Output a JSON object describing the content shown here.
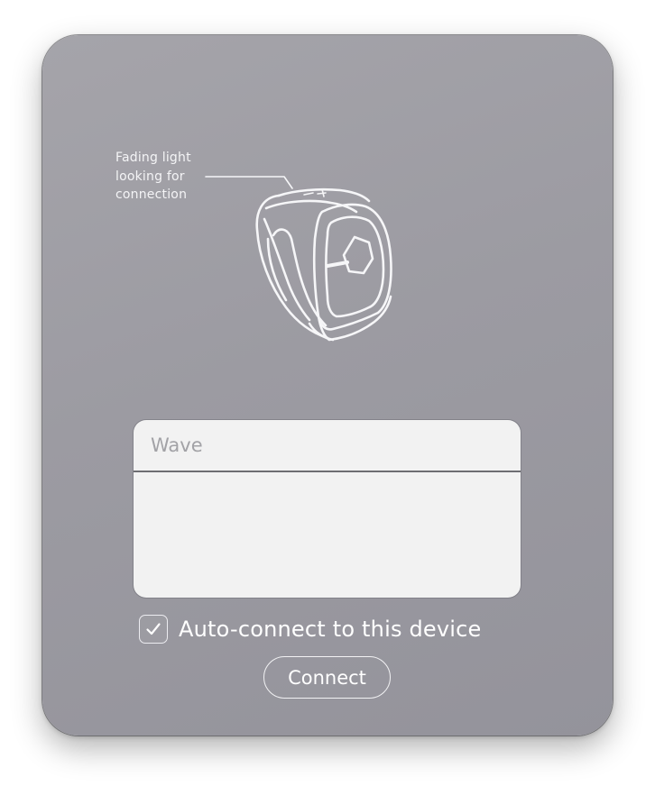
{
  "window": {
    "callout_lines": [
      "Fading light",
      "looking for",
      "connection"
    ]
  },
  "illustration": {
    "icon": "smart-ring-device"
  },
  "device_list": {
    "items": [
      {
        "label": "Wave"
      }
    ]
  },
  "auto_connect": {
    "label": "Auto-connect to this device",
    "checked": true
  },
  "connect_button": {
    "label": "Connect"
  }
}
